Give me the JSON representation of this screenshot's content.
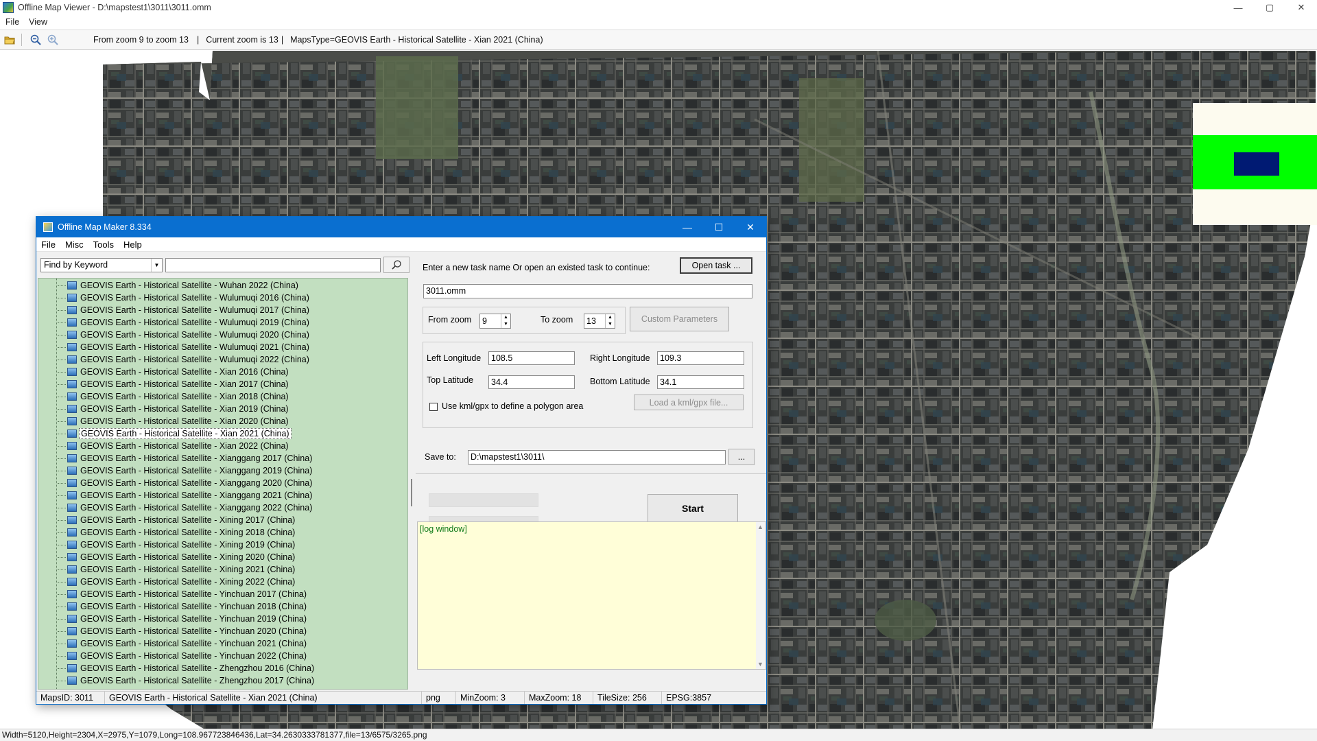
{
  "viewer": {
    "title": "Offline Map Viewer - D:\\mapstest1\\3011\\3011.omm",
    "menu": [
      "File",
      "View"
    ],
    "toolbar": {
      "zoom_range": "From zoom 9 to zoom 13",
      "current_zoom": "Current zoom is 13",
      "maps_type": "MapsType=GEOVIS Earth - Historical Satellite - Xian 2021 (China)"
    },
    "status": "Width=5120,Height=2304,X=2975,Y=1079,Long=108.967723846436,Lat=34.2630333781377,file=13/6575/3265.png",
    "window_controls": {
      "minimize": "—",
      "maximize": "▢",
      "close": "✕"
    }
  },
  "maker": {
    "title": "Offline Map Maker 8.334",
    "menu": [
      "File",
      "Misc",
      "Tools",
      "Help"
    ],
    "search": {
      "mode": "Find by Keyword",
      "keyword": ""
    },
    "maps_list": [
      "GEOVIS Earth - Historical Satellite - Wuhan 2022 (China)",
      "GEOVIS Earth - Historical Satellite - Wulumuqi 2016 (China)",
      "GEOVIS Earth - Historical Satellite - Wulumuqi 2017 (China)",
      "GEOVIS Earth - Historical Satellite - Wulumuqi 2019 (China)",
      "GEOVIS Earth - Historical Satellite - Wulumuqi 2020 (China)",
      "GEOVIS Earth - Historical Satellite - Wulumuqi 2021 (China)",
      "GEOVIS Earth - Historical Satellite - Wulumuqi 2022 (China)",
      "GEOVIS Earth - Historical Satellite - Xian 2016 (China)",
      "GEOVIS Earth - Historical Satellite - Xian 2017 (China)",
      "GEOVIS Earth - Historical Satellite - Xian 2018 (China)",
      "GEOVIS Earth - Historical Satellite - Xian 2019 (China)",
      "GEOVIS Earth - Historical Satellite - Xian 2020 (China)",
      "GEOVIS Earth - Historical Satellite - Xian 2021 (China)",
      "GEOVIS Earth - Historical Satellite - Xian 2022 (China)",
      "GEOVIS Earth - Historical Satellite - Xianggang 2017 (China)",
      "GEOVIS Earth - Historical Satellite - Xianggang 2019 (China)",
      "GEOVIS Earth - Historical Satellite - Xianggang 2020 (China)",
      "GEOVIS Earth - Historical Satellite - Xianggang 2021 (China)",
      "GEOVIS Earth - Historical Satellite - Xianggang 2022 (China)",
      "GEOVIS Earth - Historical Satellite - Xining 2017 (China)",
      "GEOVIS Earth - Historical Satellite - Xining 2018 (China)",
      "GEOVIS Earth - Historical Satellite - Xining 2019 (China)",
      "GEOVIS Earth - Historical Satellite - Xining 2020 (China)",
      "GEOVIS Earth - Historical Satellite - Xining 2021 (China)",
      "GEOVIS Earth - Historical Satellite - Xining 2022 (China)",
      "GEOVIS Earth - Historical Satellite - Yinchuan 2017 (China)",
      "GEOVIS Earth - Historical Satellite - Yinchuan 2018 (China)",
      "GEOVIS Earth - Historical Satellite - Yinchuan 2019 (China)",
      "GEOVIS Earth - Historical Satellite - Yinchuan 2020 (China)",
      "GEOVIS Earth - Historical Satellite - Yinchuan 2021 (China)",
      "GEOVIS Earth - Historical Satellite - Yinchuan 2022 (China)",
      "GEOVIS Earth - Historical Satellite - Zhengzhou 2016 (China)",
      "GEOVIS Earth - Historical Satellite - Zhengzhou 2017 (China)"
    ],
    "selected_map": "GEOVIS Earth - Historical Satellite - Xian 2021 (China)",
    "task_prompt": "Enter a new task name Or open an existed task to continue:",
    "open_task_label": "Open task ...",
    "task_name": "3011.omm",
    "from_zoom_label": "From zoom",
    "from_zoom": "9",
    "to_zoom_label": "To zoom",
    "to_zoom": "13",
    "custom_params_label": "Custom Parameters",
    "left_lon_label": "Left Longitude",
    "left_lon": "108.5",
    "right_lon_label": "Right Longitude",
    "right_lon": "109.3",
    "top_lat_label": "Top Latitude",
    "top_lat": "34.4",
    "bottom_lat_label": "Bottom Latitude",
    "bottom_lat": "34.1",
    "kml_checkbox_label": "Use kml/gpx to define a polygon area",
    "kml_button_label": "Load a kml/gpx file...",
    "save_to_label": "Save to:",
    "save_path": "D:\\mapstest1\\3011\\",
    "browse_label": "...",
    "start_label": "Start",
    "log_text": "[log window]",
    "status": {
      "maps_id": "MapsID: 3011",
      "map_name": "GEOVIS Earth - Historical Satellite - Xian 2021 (China)",
      "format": "png",
      "min_zoom": "MinZoom: 3",
      "max_zoom": "MaxZoom: 18",
      "tile_size": "TileSize: 256",
      "epsg": "EPSG:3857"
    },
    "window_controls": {
      "minimize": "—",
      "maximize": "☐",
      "close": "✕"
    }
  }
}
